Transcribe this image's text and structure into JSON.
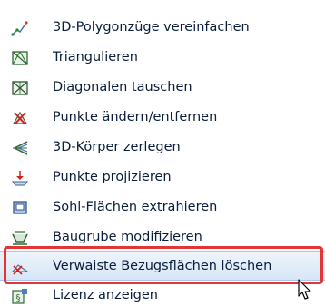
{
  "menu": {
    "items": [
      {
        "label": "3D-Polygonzüge vereinfachen",
        "icon": "polyline-simplify-icon"
      },
      {
        "label": "Triangulieren",
        "icon": "triangulate-icon"
      },
      {
        "label": "Diagonalen tauschen",
        "icon": "swap-diagonals-icon"
      },
      {
        "label": "Punkte ändern/entfernen",
        "icon": "edit-points-icon"
      },
      {
        "label": "3D-Körper zerlegen",
        "icon": "split-solid-icon"
      },
      {
        "label": "Punkte projizieren",
        "icon": "project-points-icon"
      },
      {
        "label": "Sohl-Flächen extrahieren",
        "icon": "extract-surface-icon"
      },
      {
        "label": "Baugrube modifizieren",
        "icon": "excavation-icon"
      },
      {
        "label": "Verwaiste Bezugsflächen löschen",
        "icon": "delete-orphan-surfaces-icon"
      },
      {
        "label": "Lizenz anzeigen",
        "icon": "license-icon"
      }
    ],
    "highlighted_index": 8
  },
  "colors": {
    "highlight_border": "#e23535",
    "text": "#0a1d3a"
  }
}
